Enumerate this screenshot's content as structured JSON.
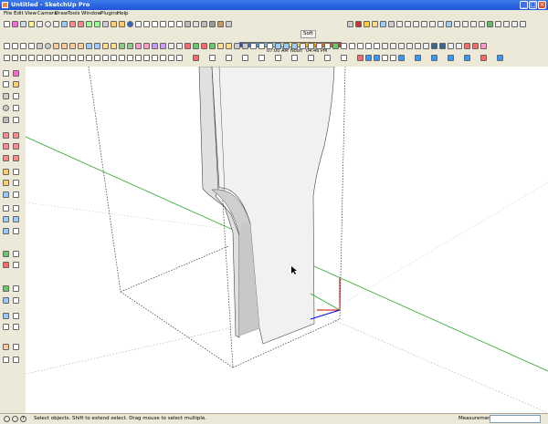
{
  "window": {
    "title": "Untitled - SketchUp Pro",
    "controls": {
      "minimize": "_",
      "maximize": "□",
      "close": "×"
    }
  },
  "menu": [
    "File",
    "Edit",
    "View",
    "Camera",
    "Draw",
    "Tools",
    "Window",
    "Plugins",
    "Help"
  ],
  "toolbar": {
    "shadow_times": [
      "07:00 AM",
      "Noon",
      "04:46 PM"
    ],
    "soft_label": "Soft"
  },
  "status": {
    "hint": "Select objects. Shift to extend select. Drag mouse to select multiple.",
    "measurements_label": "Measurements",
    "measurements_value": ""
  },
  "icons": [
    "cursor-icon",
    "eraser-icon",
    "pencil-icon",
    "arc-icon",
    "rectangle-icon",
    "circle-icon",
    "push-pull-icon",
    "move-icon",
    "rotate-icon",
    "scale-icon",
    "offset-icon",
    "tape-measure-icon",
    "paint-bucket-icon",
    "orbit-icon",
    "pan-icon",
    "zoom-icon",
    "zoom-extents-icon",
    "walk-icon",
    "look-around-icon",
    "section-plane-icon"
  ],
  "colors": {
    "green_axis": "#2aa82a",
    "red_axis": "#d00000",
    "blue_axis": "#0000ff",
    "chrome": "#ece9d8",
    "titlebar": "#2358d9"
  }
}
